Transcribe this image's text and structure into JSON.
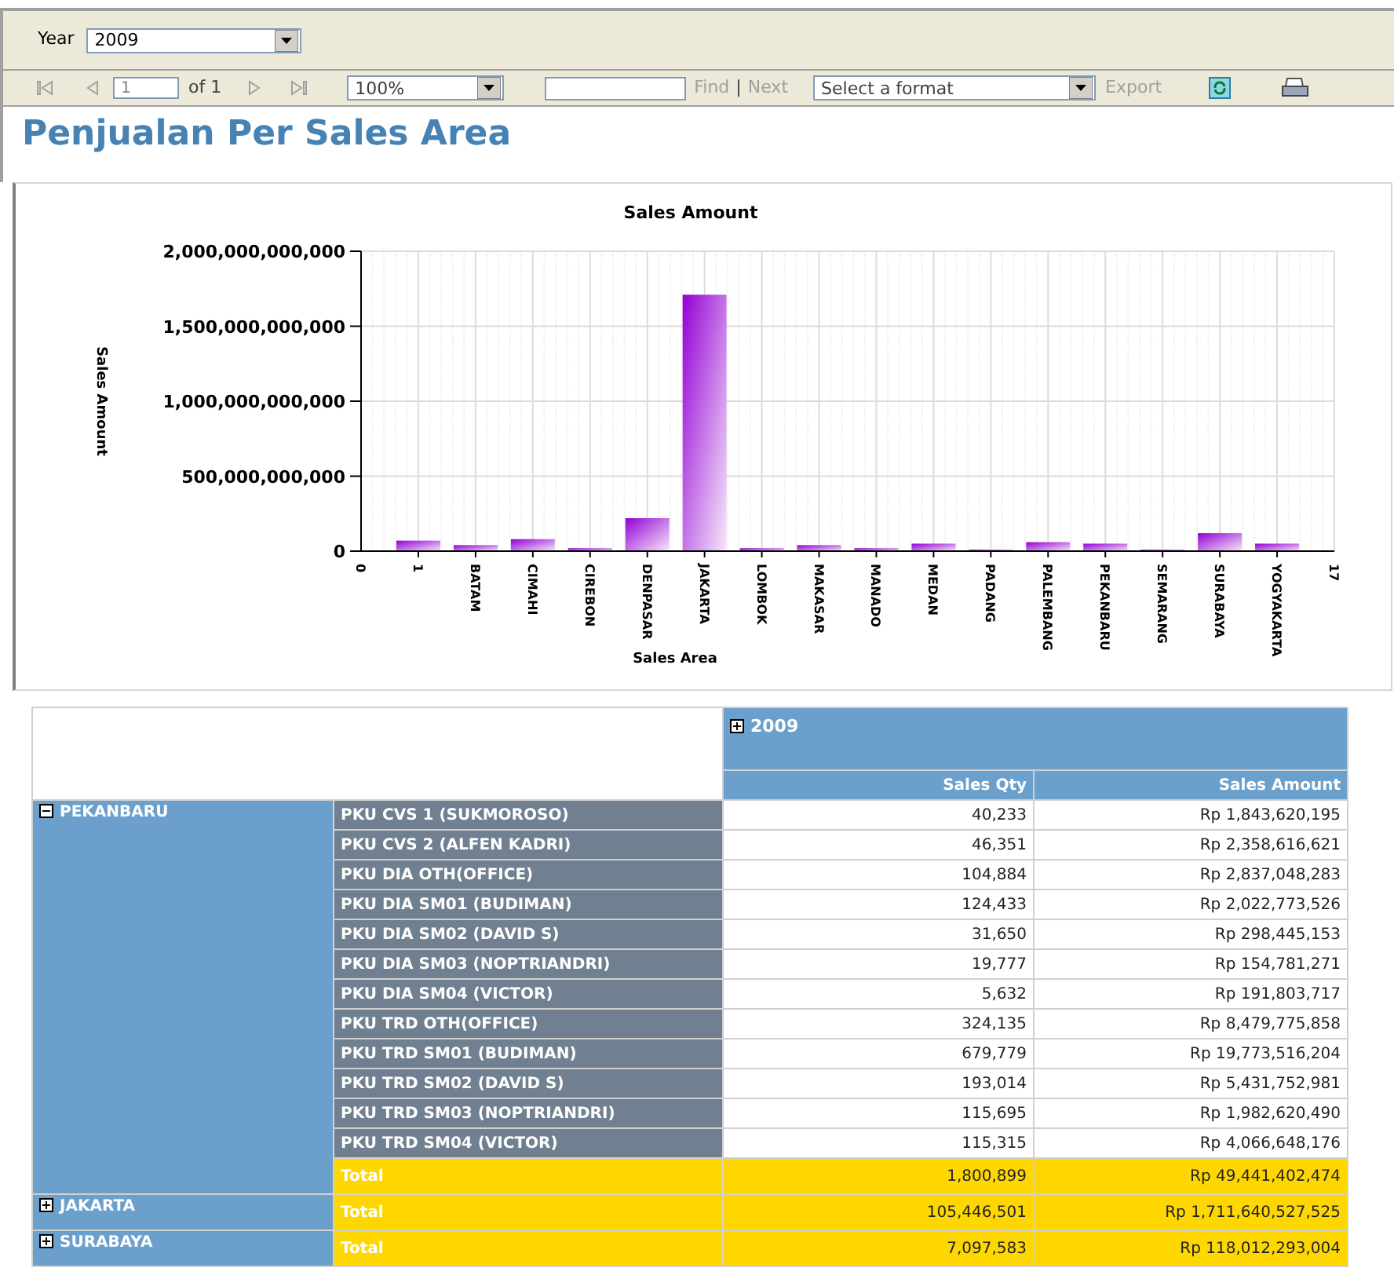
{
  "parameters": {
    "label": "Year",
    "value": "2009"
  },
  "toolbar": {
    "page": "1",
    "page_of": "of 1",
    "zoom": "100%",
    "find_label": "Find",
    "separator": "|",
    "next_label": "Next",
    "format": "Select a format",
    "export_label": "Export"
  },
  "report_title": "Penjualan Per Sales Area",
  "chart_data": {
    "type": "bar",
    "title": "Sales Amount",
    "xlabel": "Sales Area",
    "ylabel": "Sales Amount",
    "categories": [
      "1",
      "BATAM",
      "CIMAHI",
      "CIREBON",
      "DENPASAR",
      "JAKARTA",
      "LOMBOK",
      "MAKASAR",
      "MANADO",
      "MEDAN",
      "PADANG",
      "PALEMBANG",
      "PEKANBARU",
      "SEMARANG",
      "SURABAYA",
      "YOGYAKARTA"
    ],
    "series": [
      {
        "color": "#9400d3",
        "values": [
          70000000000,
          40000000000,
          80000000000,
          20000000000,
          220000000000,
          1710000000000,
          20000000000,
          40000000000,
          20000000000,
          50000000000,
          10000000000,
          60000000000,
          50000000000,
          10000000000,
          120000000000,
          50000000000
        ]
      }
    ],
    "grid": true,
    "ylim": [
      0,
      2000000000000
    ],
    "yticks": [
      {
        "value": 0,
        "label": "0"
      },
      {
        "value": 500000000000,
        "label": "500,000,000,000"
      },
      {
        "value": 1000000000000,
        "label": "1,000,000,000,000"
      },
      {
        "value": 1500000000000,
        "label": "1,500,000,000,000"
      },
      {
        "value": 2000000000000,
        "label": "2,000,000,000,000"
      }
    ]
  },
  "chart_axis_end_labels": {
    "start": "0",
    "end": "17"
  },
  "matrix": {
    "column_group": {
      "label": "2009",
      "expanded": false
    },
    "measures": [
      "Sales Qty",
      "Sales Amount"
    ],
    "groups": [
      {
        "name": "PEKANBARU",
        "expanded": true,
        "rows": [
          {
            "label": "PKU CVS 1 (SUKMOROSO)",
            "qty": "40,233",
            "amount": "Rp 1,843,620,195"
          },
          {
            "label": "PKU CVS 2 (ALFEN KADRI)",
            "qty": "46,351",
            "amount": "Rp 2,358,616,621"
          },
          {
            "label": "PKU DIA OTH(OFFICE)",
            "qty": "104,884",
            "amount": "Rp 2,837,048,283"
          },
          {
            "label": "PKU DIA SM01 (BUDIMAN)",
            "qty": "124,433",
            "amount": "Rp 2,022,773,526"
          },
          {
            "label": "PKU DIA SM02 (DAVID S)",
            "qty": "31,650",
            "amount": "Rp 298,445,153"
          },
          {
            "label": "PKU DIA SM03 (NOPTRIANDRI)",
            "qty": "19,777",
            "amount": "Rp 154,781,271"
          },
          {
            "label": "PKU DIA SM04 (VICTOR)",
            "qty": "5,632",
            "amount": "Rp 191,803,717"
          },
          {
            "label": "PKU TRD OTH(OFFICE)",
            "qty": "324,135",
            "amount": "Rp 8,479,775,858"
          },
          {
            "label": "PKU TRD SM01 (BUDIMAN)",
            "qty": "679,779",
            "amount": "Rp 19,773,516,204"
          },
          {
            "label": "PKU TRD SM02 (DAVID S)",
            "qty": "193,014",
            "amount": "Rp 5,431,752,981"
          },
          {
            "label": "PKU TRD SM03 (NOPTRIANDRI)",
            "qty": "115,695",
            "amount": "Rp 1,982,620,490"
          },
          {
            "label": "PKU TRD SM04 (VICTOR)",
            "qty": "115,315",
            "amount": "Rp 4,066,648,176"
          }
        ],
        "total": {
          "label": "Total",
          "qty": "1,800,899",
          "amount": "Rp 49,441,402,474"
        }
      },
      {
        "name": "JAKARTA",
        "expanded": false,
        "total": {
          "label": "Total",
          "qty": "105,446,501",
          "amount": "Rp 1,711,640,527,525"
        }
      },
      {
        "name": "SURABAYA",
        "expanded": false,
        "total": {
          "label": "Total",
          "qty": "7,097,583",
          "amount": "Rp 118,012,293,004"
        }
      }
    ]
  }
}
